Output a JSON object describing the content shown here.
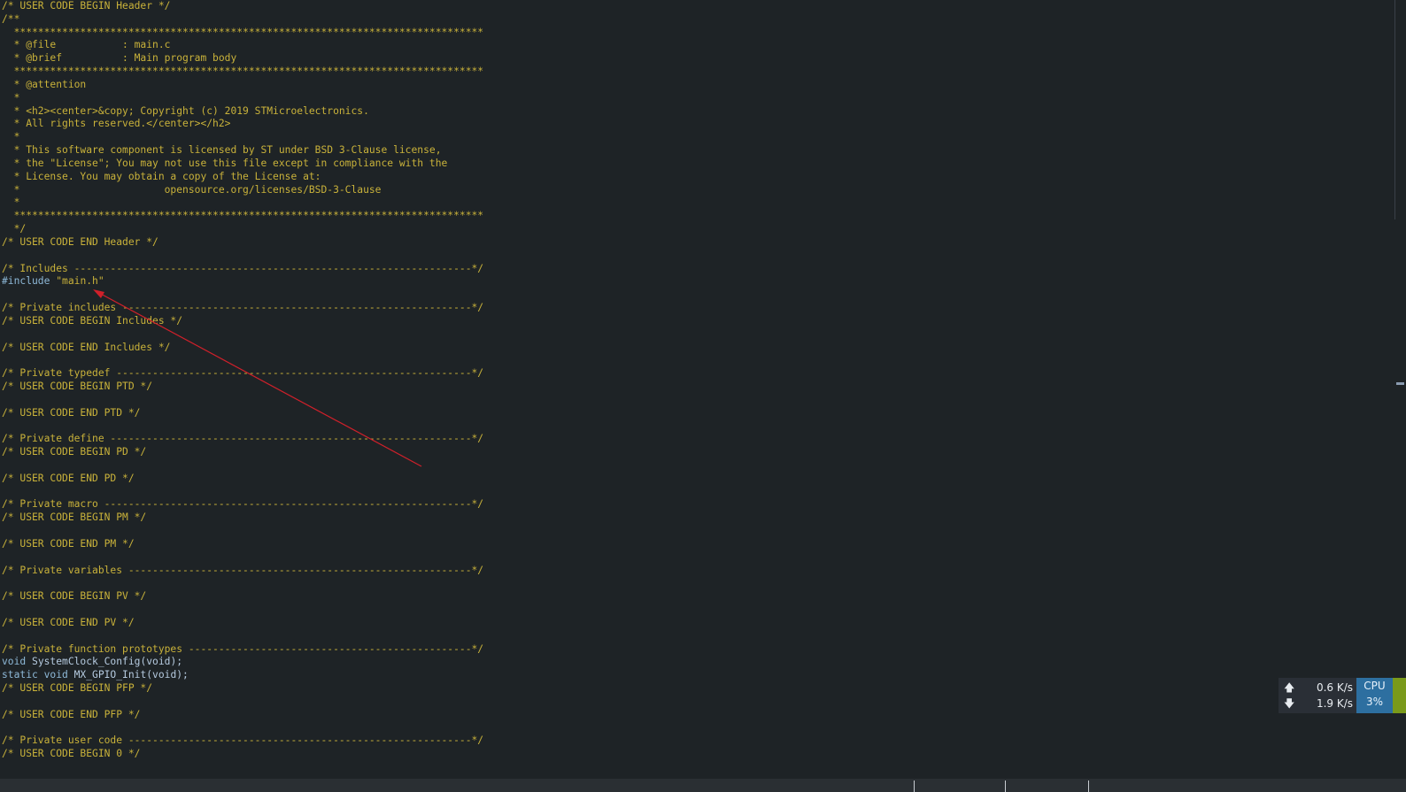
{
  "code": {
    "lines": [
      "/* USER CODE BEGIN Header */",
      "/**",
      "  ******************************************************************************",
      "  * @file           : main.c",
      "  * @brief          : Main program body",
      "  ******************************************************************************",
      "  * @attention",
      "  *",
      "  * <h2><center>&copy; Copyright (c) 2019 STMicroelectronics.",
      "  * All rights reserved.</center></h2>",
      "  *",
      "  * This software component is licensed by ST under BSD 3-Clause license,",
      "  * the \"License\"; You may not use this file except in compliance with the",
      "  * License. You may obtain a copy of the License at:",
      "  *                        opensource.org/licenses/BSD-3-Clause",
      "  *",
      "  ******************************************************************************",
      "  */",
      "/* USER CODE END Header */",
      "",
      "/* Includes ------------------------------------------------------------------*/",
      "",
      "",
      "/* Private includes ----------------------------------------------------------*/",
      "/* USER CODE BEGIN Includes */",
      "",
      "/* USER CODE END Includes */",
      "",
      "/* Private typedef -----------------------------------------------------------*/",
      "/* USER CODE BEGIN PTD */",
      "",
      "/* USER CODE END PTD */",
      "",
      "/* Private define ------------------------------------------------------------*/",
      "/* USER CODE BEGIN PD */",
      "",
      "/* USER CODE END PD */",
      "",
      "/* Private macro -------------------------------------------------------------*/",
      "/* USER CODE BEGIN PM */",
      "",
      "/* USER CODE END PM */",
      "",
      "/* Private variables ---------------------------------------------------------*/",
      "",
      "/* USER CODE BEGIN PV */",
      "",
      "/* USER CODE END PV */",
      "",
      "/* Private function prototypes -----------------------------------------------*/",
      "",
      "",
      "/* USER CODE BEGIN PFP */",
      "",
      "/* USER CODE END PFP */",
      "",
      "/* Private user code ---------------------------------------------------------*/",
      "/* USER CODE BEGIN 0 */"
    ],
    "include_keyword": "#include",
    "include_file": "\"main.h\"",
    "proto1_kw": "void",
    "proto1_rest": " SystemClock_Config(void);",
    "proto2_kw": "static void",
    "proto2_rest": " MX_GPIO_Init(void);"
  },
  "network_monitor": {
    "upload_icon": "arrow-up-icon",
    "upload_rate": "0.6 K/s",
    "download_icon": "arrow-down-icon",
    "download_rate": "1.9 K/s"
  },
  "cpu_widget": {
    "label": "CPU",
    "value": "3%"
  },
  "colors": {
    "background": "#1e2326",
    "comment": "#c9b23a",
    "keyword": "#8eb9d8",
    "annotation_arrow": "#d0202a"
  }
}
